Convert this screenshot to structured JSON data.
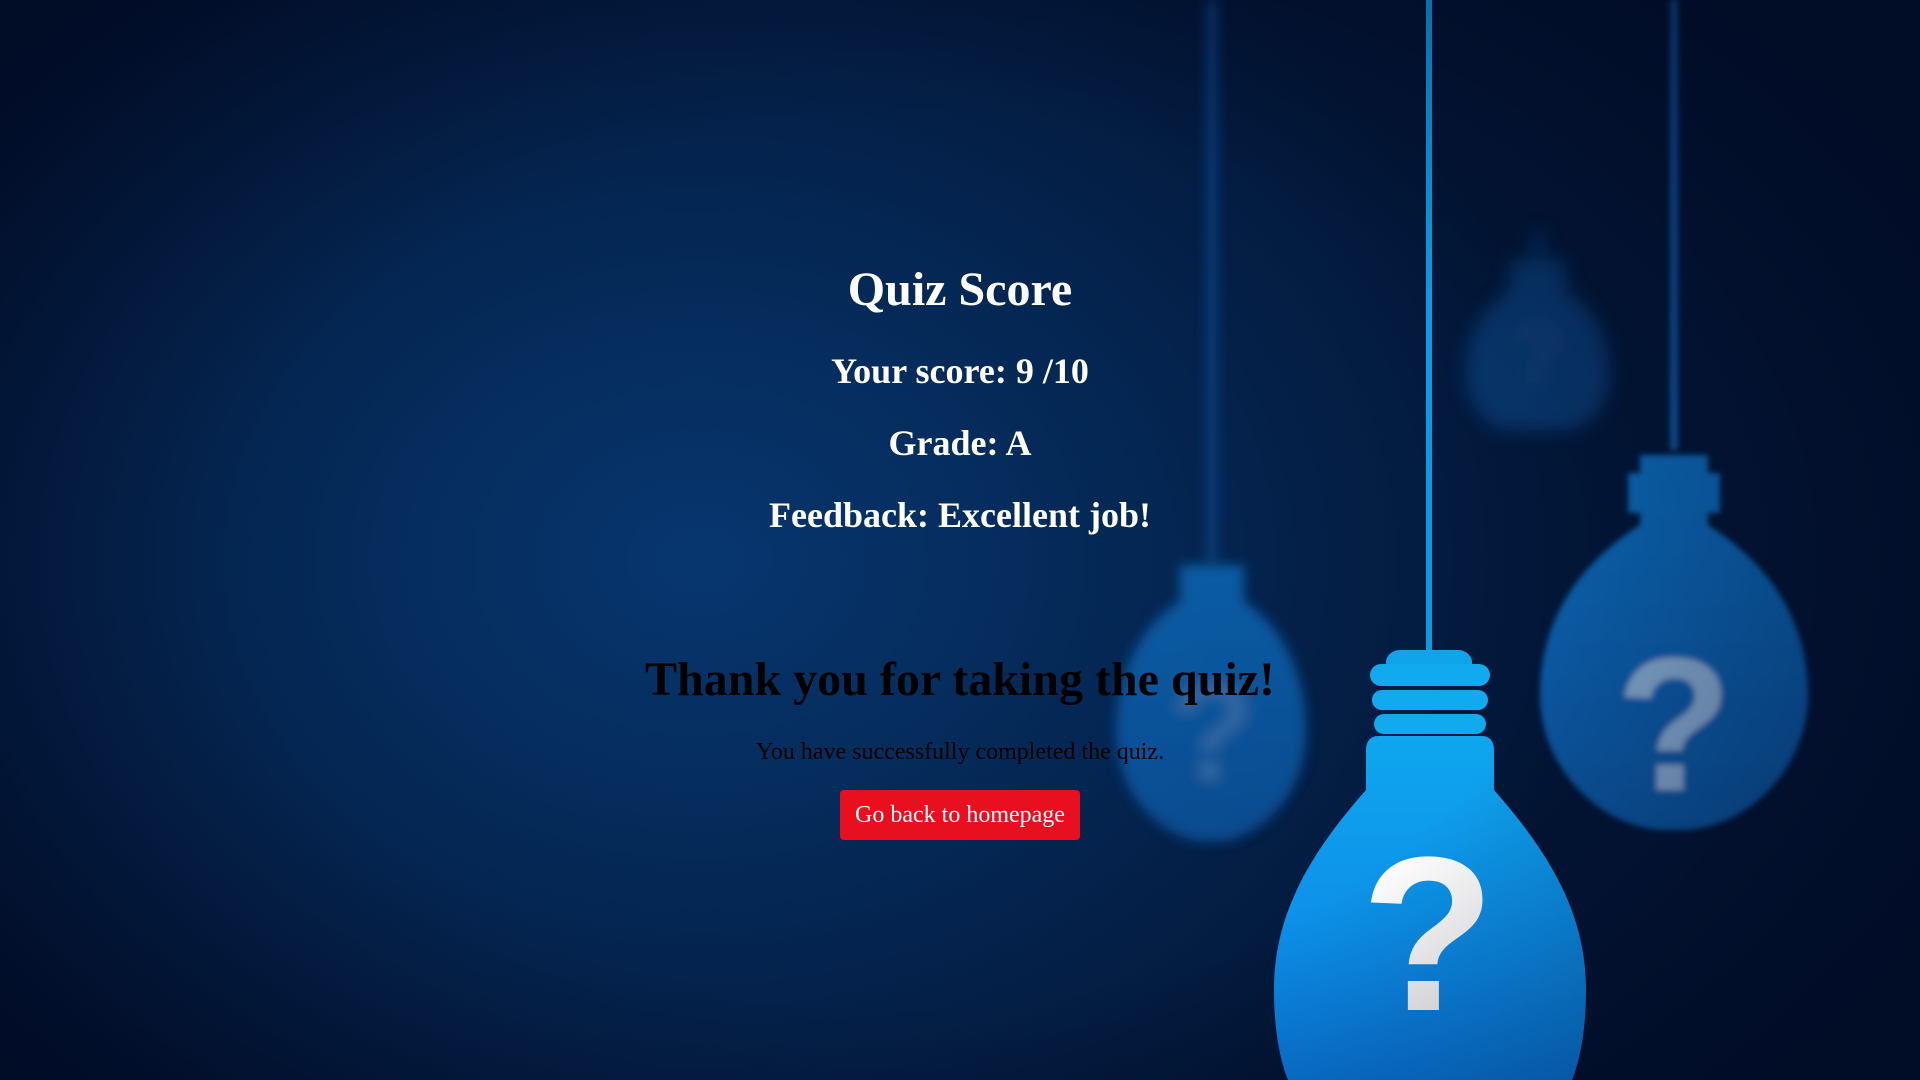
{
  "quiz": {
    "title": "Quiz Score",
    "score_line": "Your score: 9 /10",
    "grade_line": "Grade: A",
    "feedback_line": "Feedback: Excellent job!"
  },
  "completion": {
    "heading": "Thank you for taking the quiz!",
    "message": "You have successfully completed the quiz.",
    "home_button_label": "Go back to homepage"
  },
  "background": {
    "icon": "lightbulb-question-icon",
    "bulb_colors": {
      "main": "#0a8be8",
      "dim": "#0b5fa8"
    },
    "page_color": "#04285a"
  },
  "colors": {
    "button": "#e8101f",
    "heading_text": "#ffffff",
    "body_text": "#000000"
  }
}
